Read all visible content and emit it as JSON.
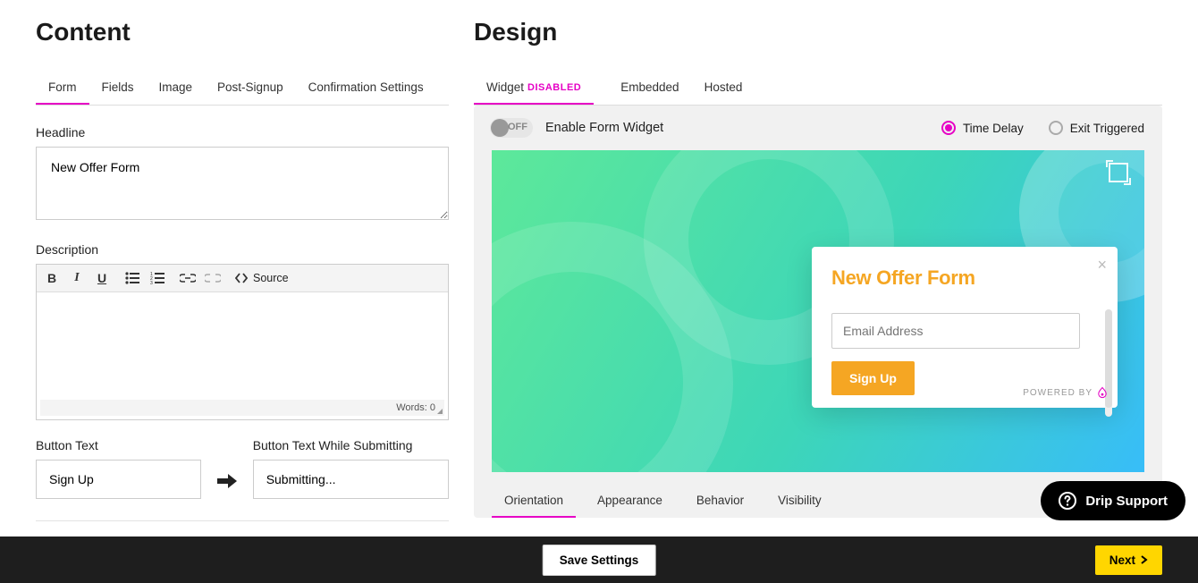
{
  "content": {
    "title": "Content",
    "tabs": [
      "Form",
      "Fields",
      "Image",
      "Post-Signup",
      "Confirmation Settings"
    ],
    "active_tab": 0,
    "headline_label": "Headline",
    "headline_value": "New Offer Form",
    "description_label": "Description",
    "editor": {
      "source_label": "Source",
      "words_label": "Words: 0"
    },
    "button_text_label": "Button Text",
    "button_text_value": "Sign Up",
    "submitting_label": "Button Text While Submitting",
    "submitting_value": "Submitting..."
  },
  "design": {
    "title": "Design",
    "tabs": [
      {
        "label": "Widget",
        "badge": "DISABLED"
      },
      {
        "label": "Embedded",
        "badge": null
      },
      {
        "label": "Hosted",
        "badge": null
      }
    ],
    "active_tab": 0,
    "toggle_off_label": "OFF",
    "enable_label": "Enable Form Widget",
    "radio_time_delay": "Time Delay",
    "radio_exit": "Exit Triggered",
    "popup": {
      "title": "New Offer Form",
      "email_placeholder": "Email Address",
      "button": "Sign Up",
      "powered_by": "POWERED BY"
    },
    "inner_tabs": [
      "Orientation",
      "Appearance",
      "Behavior",
      "Visibility"
    ],
    "inner_active": 0
  },
  "support_label": "Drip Support",
  "footer": {
    "save": "Save Settings",
    "next": "Next"
  }
}
